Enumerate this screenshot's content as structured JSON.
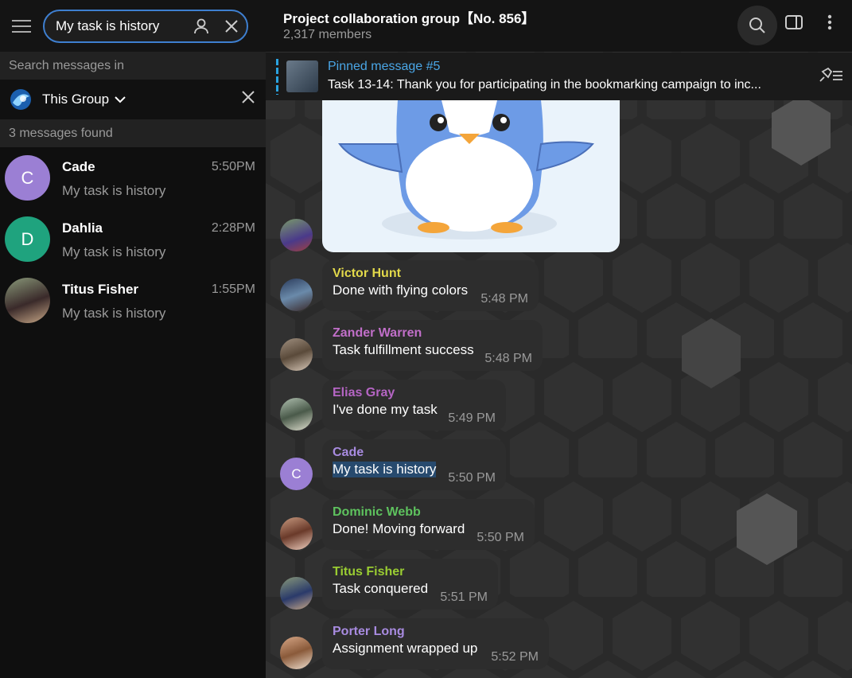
{
  "search": {
    "query": "My task is history",
    "search_in_label": "Search messages in",
    "scope": "This Group",
    "found": "3 messages found"
  },
  "results": [
    {
      "initial": "C",
      "name": "Cade",
      "time": "5:50PM",
      "text": "My task is history",
      "color": "#9b7fd4"
    },
    {
      "initial": "D",
      "name": "Dahlia",
      "time": "2:28PM",
      "text": "My task is history",
      "color": "#1fa37e"
    },
    {
      "initial": "",
      "name": "Titus Fisher",
      "time": "1:55PM",
      "text": "My task is history",
      "color": "#6a5a4a"
    }
  ],
  "chat": {
    "title": "Project collaboration group【No. 856】",
    "members": "2,317 members",
    "pinned_title": "Pinned message #5",
    "pinned_text": "Task 13-14:  Thank you for participating in the bookmarking campaign to inc..."
  },
  "messages": [
    {
      "name": "Victor Hunt",
      "text": "Done with flying colors",
      "time": "5:48 PM",
      "color": "#e2d94a",
      "avatar_initial": "",
      "avatar_color": "#3a4a6a"
    },
    {
      "name": "Zander Warren",
      "text": "Task fulfillment success",
      "time": "5:48 PM",
      "color": "#c16fc9",
      "avatar_initial": "",
      "avatar_color": "#8a7a6a"
    },
    {
      "name": "Elias Gray",
      "text": "I've done my task",
      "time": "5:49 PM",
      "color": "#b565c4",
      "avatar_initial": "",
      "avatar_color": "#7a8a7a"
    },
    {
      "name": "Cade",
      "text": "My task is history",
      "time": "5:50 PM",
      "color": "#a88be0",
      "avatar_initial": "C",
      "avatar_color": "#9b7fd4"
    },
    {
      "name": "Dominic Webb",
      "text": "Done! Moving forward",
      "time": "5:50 PM",
      "color": "#5ec25e",
      "avatar_initial": "",
      "avatar_color": "#9a7060"
    },
    {
      "name": "Titus Fisher",
      "text": "Task conquered",
      "time": "5:51 PM",
      "color": "#9acd32",
      "avatar_initial": "",
      "avatar_color": "#6a5a4a"
    },
    {
      "name": "Porter Long",
      "text": "Assignment wrapped up",
      "time": "5:52 PM",
      "color": "#a88be0",
      "avatar_initial": "",
      "avatar_color": "#b07a5a"
    }
  ]
}
